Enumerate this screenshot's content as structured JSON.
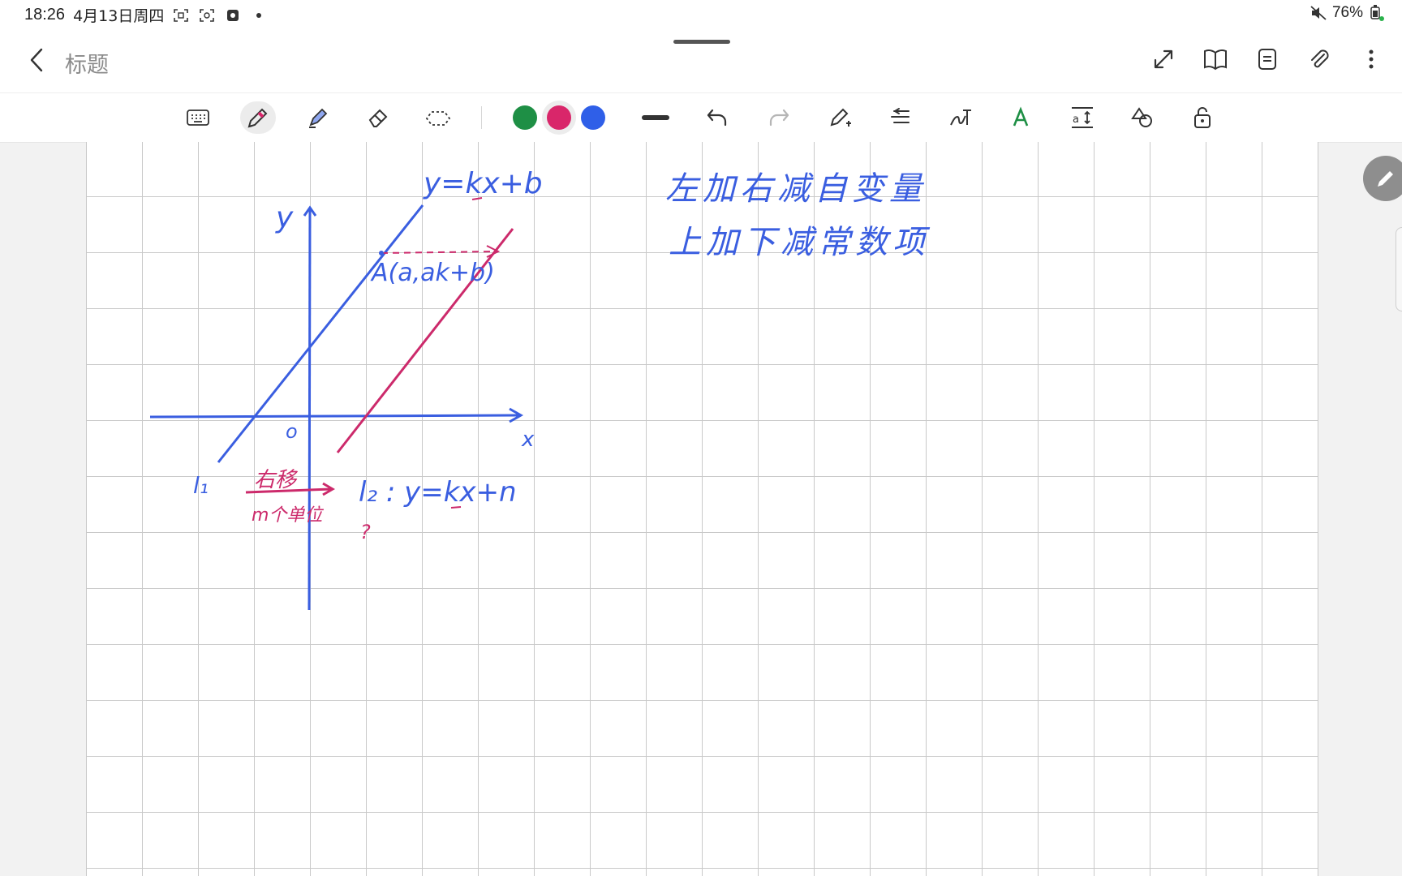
{
  "status_bar": {
    "time": "18:26",
    "date": "4月13日周四",
    "battery": "76%",
    "icons": [
      "scan-icon",
      "scan-icon",
      "app-icon",
      "dot-icon",
      "mute-icon",
      "battery-icon"
    ]
  },
  "header": {
    "title": "标题",
    "actions": [
      "expand-icon",
      "book-icon",
      "document-icon",
      "attachment-icon",
      "more-icon"
    ]
  },
  "toolbar": {
    "tools": [
      "keyboard-icon",
      "pen-icon",
      "highlighter-icon",
      "eraser-icon",
      "lasso-icon"
    ],
    "colors": [
      "#1e8f45",
      "#d9266a",
      "#2f5fe8"
    ],
    "selected_color": "#d9266a",
    "extra_tools": [
      "undo-icon",
      "redo-icon",
      "pen-settings-icon",
      "format-icon",
      "handwriting-icon",
      "text-style-icon",
      "text-size-icon",
      "shapes-icon",
      "lock-icon"
    ]
  },
  "notes": {
    "line1": "左加右减自变量",
    "line2": "上加下减常数项"
  },
  "sketch": {
    "eq_top": "y=kx+b",
    "axis_y": "y",
    "axis_x": "x",
    "origin": "o",
    "point_a": "A(a,ak+b)",
    "l1": "l₁",
    "shift_label": "右移",
    "shift_amount": "m个单位",
    "l2": "l₂ : y=kx+n",
    "question": "?"
  },
  "colors": {
    "ink_blue": "#3a5ee0",
    "ink_pink": "#cc2a6b",
    "grid": "#c9c9c9"
  }
}
